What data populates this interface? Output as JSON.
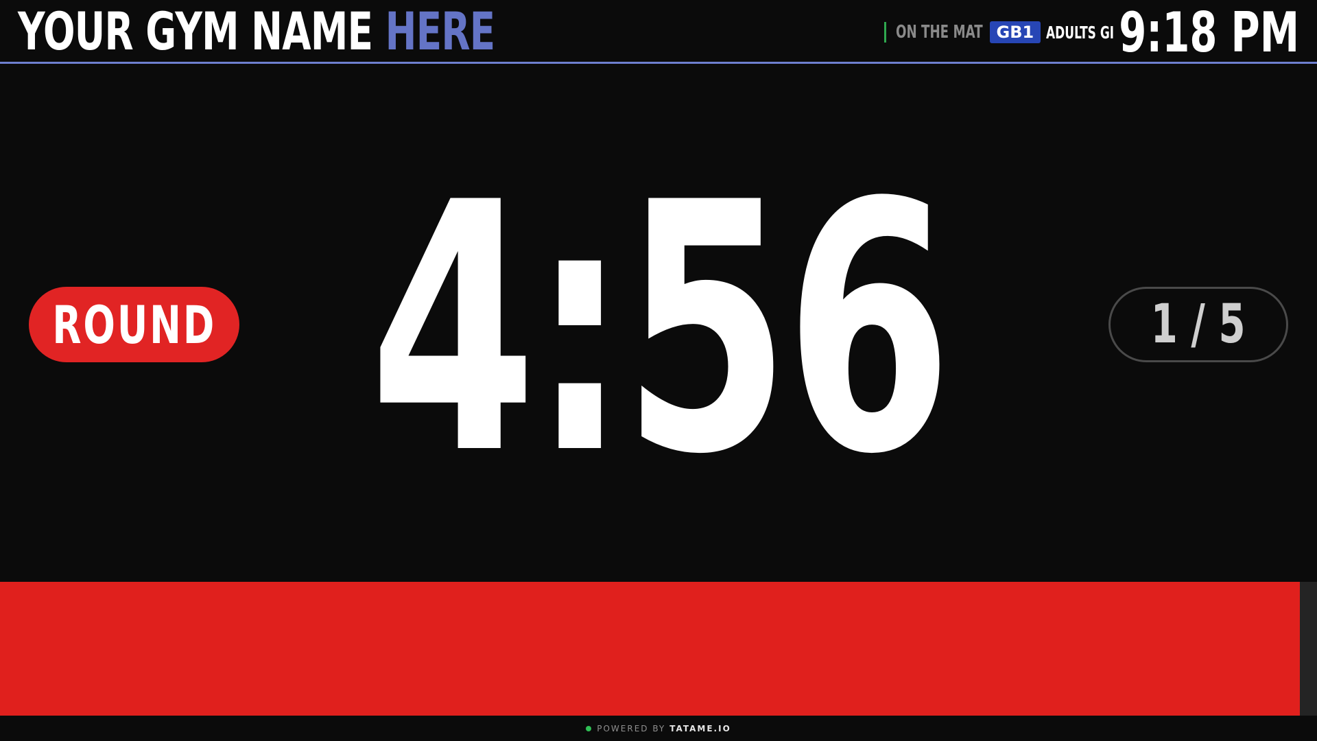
{
  "header": {
    "gym_name_main": "YOUR GYM NAME",
    "gym_name_accent": "HERE",
    "on_the_mat_label": "ON THE MAT",
    "mat_badge": "GB1",
    "class_name": "ADULTS GI",
    "clock": "9:18 PM"
  },
  "main": {
    "phase_label": "ROUND",
    "timer": "4:56",
    "round_counter": "1 / 5"
  },
  "progress": {
    "fraction_remaining": 0.987
  },
  "footer": {
    "powered_by": "POWERED BY",
    "brand": "TATAME.IO"
  },
  "colors": {
    "accent_blue": "#6474c6",
    "round_red": "#e12424",
    "progress_red": "#e0201d",
    "badge_blue": "#2746b5",
    "status_green": "#2fbf55",
    "background": "#0b0b0b"
  }
}
